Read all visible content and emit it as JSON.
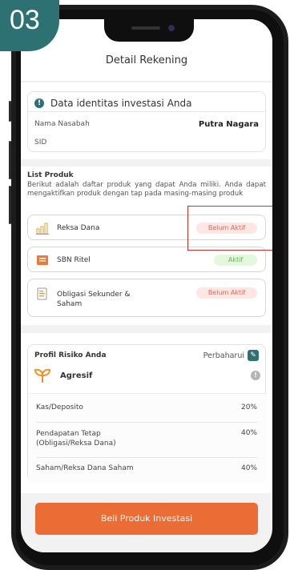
{
  "step_badge": "03",
  "header": {
    "title": "Detail Rekening"
  },
  "identity": {
    "title": "Data identitas investasi Anda",
    "name_label": "Nama Nasabah",
    "name_value": "Putra Nagara",
    "sid_label": "SID",
    "sid_value": ""
  },
  "products": {
    "title": "List Produk",
    "description": "Berikut adalah daftar produk yang dapat Anda miliki. Anda dapat mengaktifkan produk dengan tap pada masing-masing produk",
    "items": [
      {
        "name": "Reksa Dana",
        "status": "Belum Aktif",
        "icon": "bar-chart-icon"
      },
      {
        "name": "SBN Ritel",
        "status": "Aktif",
        "icon": "bond-icon"
      },
      {
        "name": "Obligasi Sekunder & Saham",
        "status": "Belum Aktif",
        "icon": "document-icon"
      }
    ]
  },
  "risk": {
    "title": "Profil Risiko Anda",
    "update_label": "Perbaharui",
    "profile": "Agresif",
    "allocations": [
      {
        "label": "Kas/Deposito",
        "pct": "20%"
      },
      {
        "label": "Pendapatan Tetap (Obligasi/Reksa Dana)",
        "pct": "40%"
      },
      {
        "label": "Saham/Reksa Dana Saham",
        "pct": "40%"
      }
    ]
  },
  "cta": {
    "label": "Beli Produk Investasi"
  },
  "colors": {
    "accent": "#2e7173",
    "cta": "#ec6c35",
    "inactive": "#e06a55",
    "active": "#5fba4b"
  }
}
